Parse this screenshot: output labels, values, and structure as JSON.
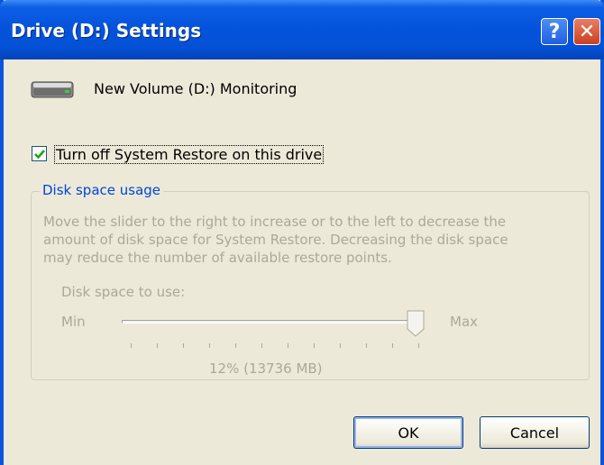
{
  "window": {
    "title": "Drive (D:) Settings"
  },
  "titlebar": {
    "help_glyph": "?",
    "close_glyph": "✕"
  },
  "drive": {
    "label": "New Volume (D:)  Monitoring",
    "icon": "hard-drive-icon"
  },
  "restore": {
    "checked": true,
    "label": "Turn off System Restore on this drive"
  },
  "disk_usage": {
    "group_title": "Disk space usage",
    "description_lines": [
      "Move the slider to the right to increase or to the left to decrease the",
      "amount of disk space for System Restore. Decreasing the disk space",
      "may reduce the number of available restore points."
    ],
    "usage_label": "Disk space to use:",
    "min_label": "Min",
    "max_label": "Max",
    "slider_level": 1.0,
    "value_text": "12% (13736 MB)",
    "disabled": true
  },
  "buttons": {
    "ok": "OK",
    "cancel": "Cancel"
  },
  "colors": {
    "title_bar": "#0553dc",
    "dialog_bg": "#ece9d8",
    "group_title": "#0046d5",
    "disabled_text": "#aca899",
    "checkmark": "#21a121"
  }
}
